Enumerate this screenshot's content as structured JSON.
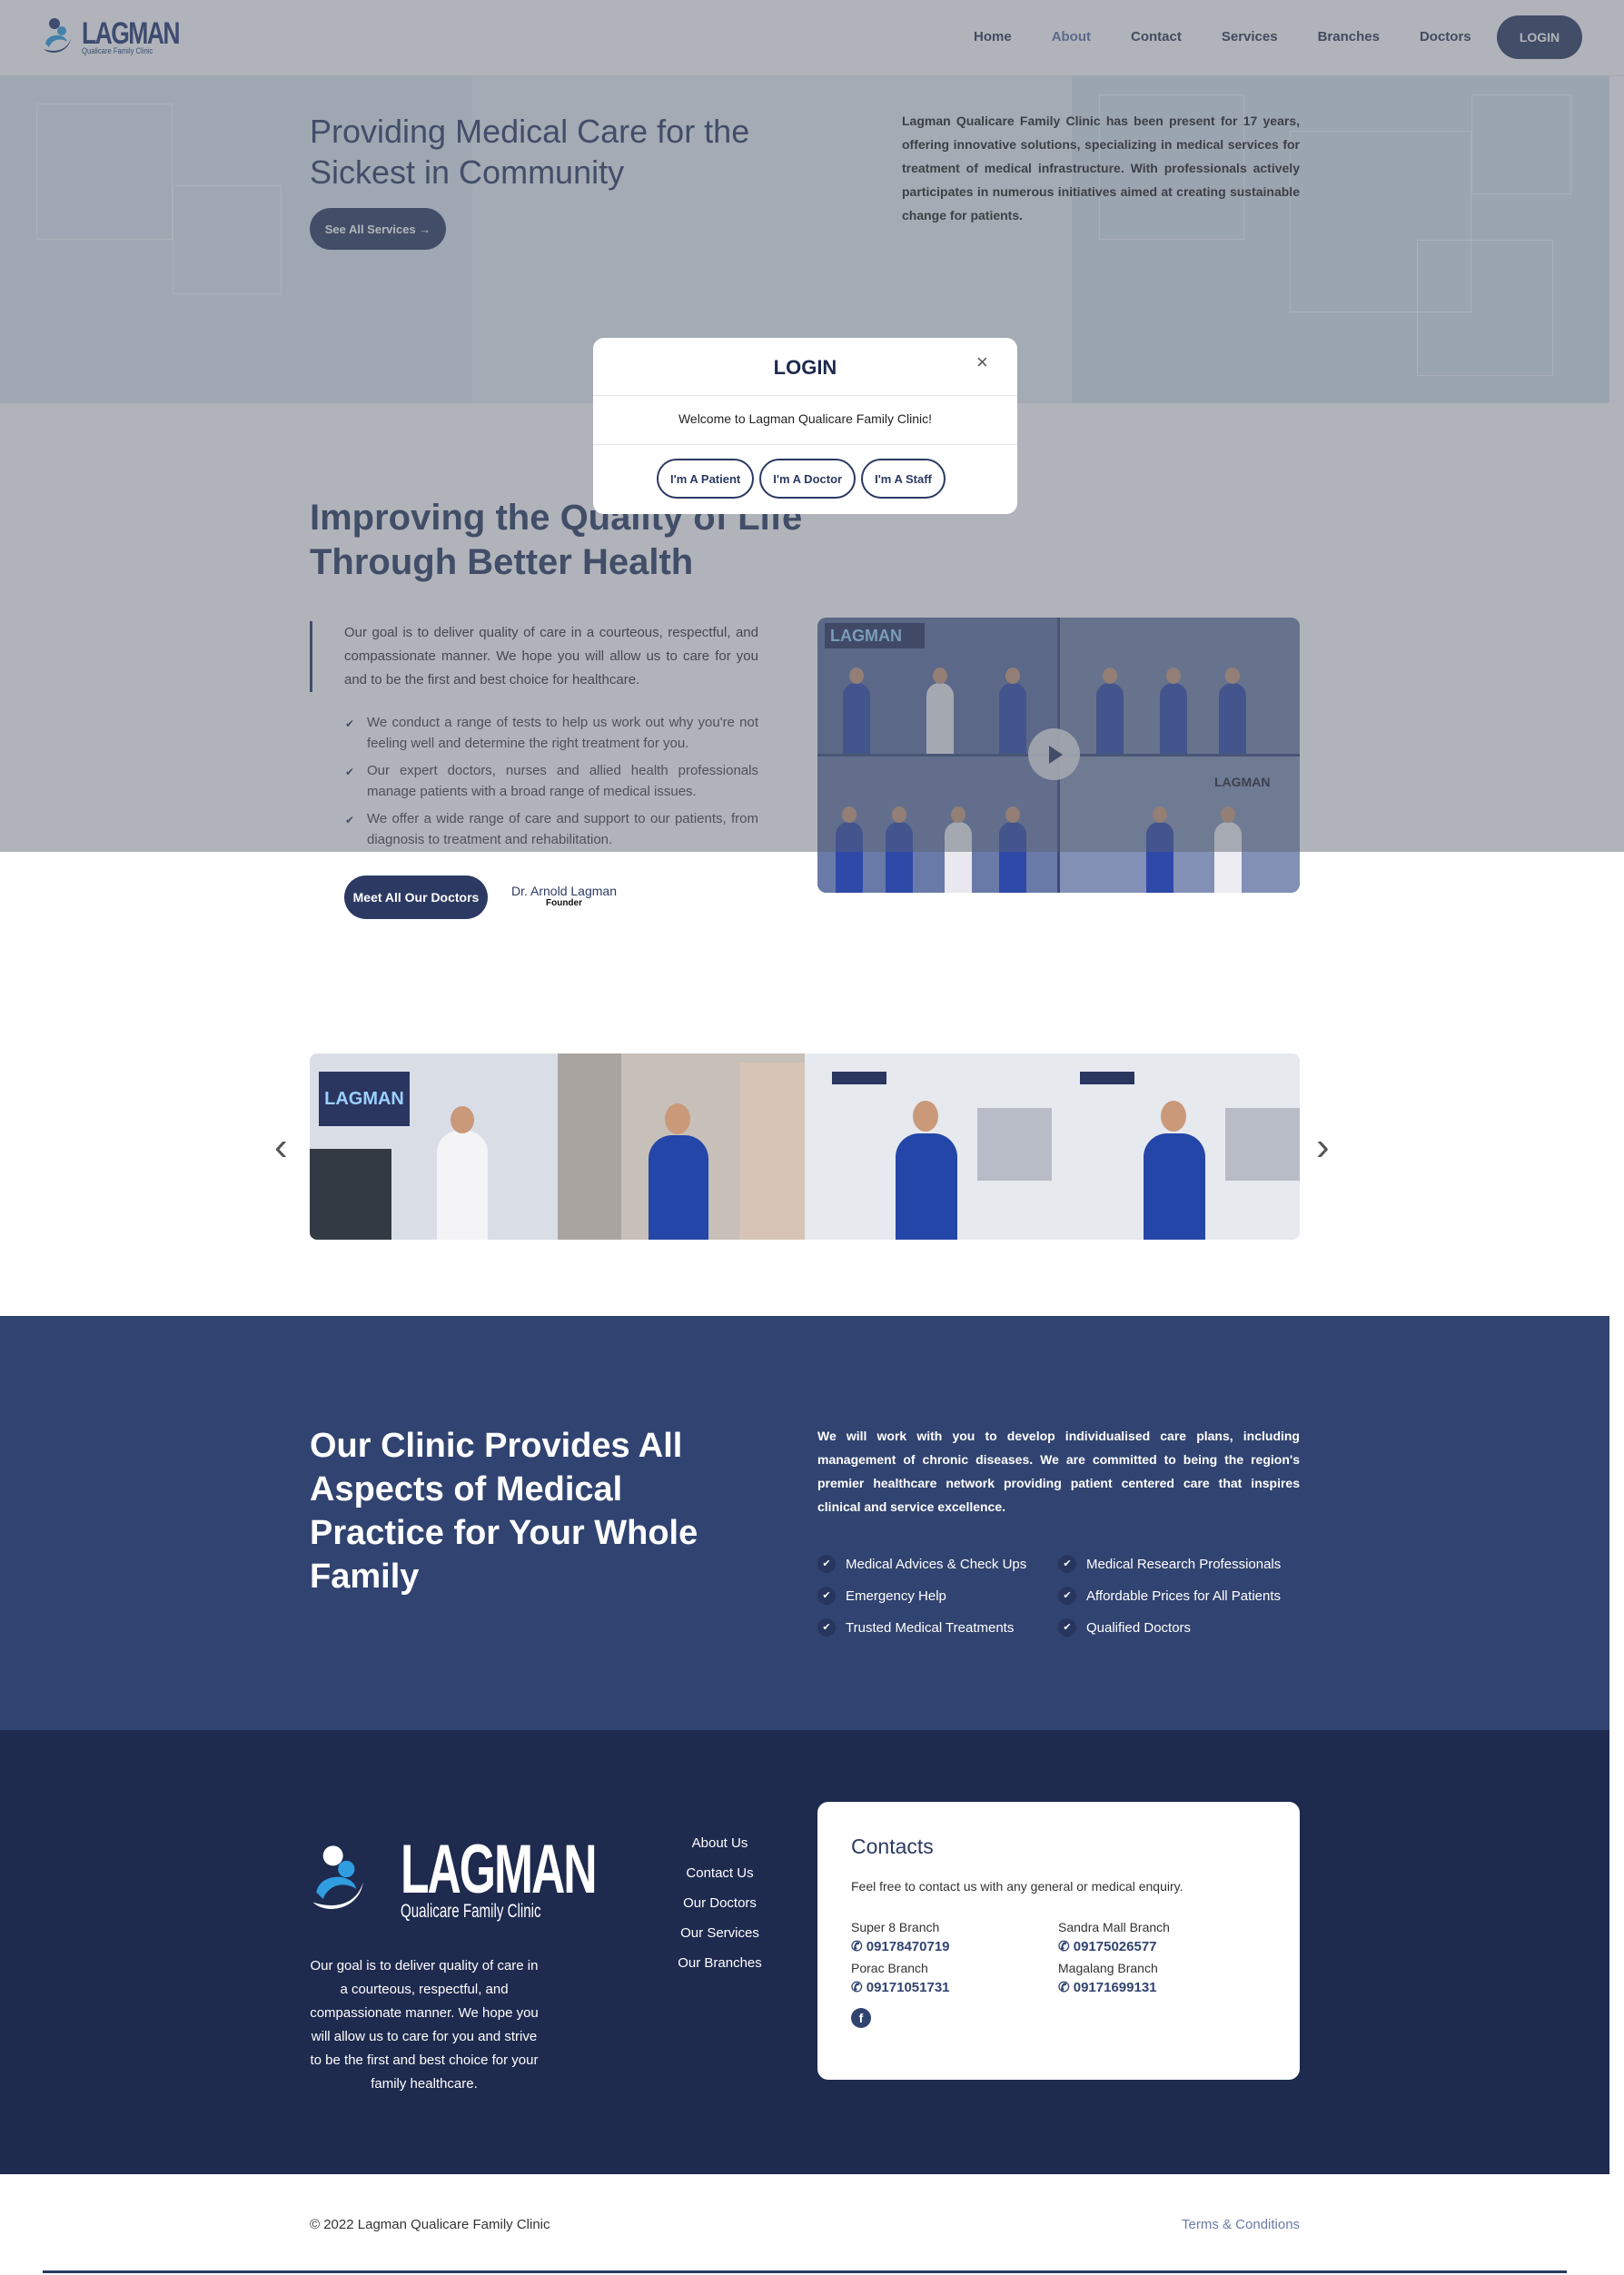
{
  "header": {
    "logo_title": "LAGMAN",
    "logo_subtitle": "Qualicare Family Clinic",
    "nav": [
      "Home",
      "About",
      "Contact",
      "Services",
      "Branches",
      "Doctors"
    ],
    "active_nav": "About",
    "login_label": "LOGIN"
  },
  "hero": {
    "title": "Providing Medical Care for the Sickest in Community",
    "button_label": "See All Services →",
    "text": "Lagman Qualicare Family Clinic has been present for 17 years, offering innovative solutions, specializing in medical services for treatment of medical infrastructure. With professionals actively participates in numerous initiatives aimed at creating sustainable change for patients."
  },
  "about": {
    "title": "Improving the Quality of Life Through Better Health",
    "quote": "Our goal is to deliver quality of care in a courteous, respectful, and compassionate manner. We hope you will allow us to care for you and to be the first and best choice for healthcare.",
    "points": [
      "We conduct a range of tests to help us work out why you're not feeling well and determine the right treatment for you.",
      "Our expert doctors, nurses and allied health professionals manage patients with a broad range of medical issues.",
      "We offer a wide range of care and support to our patients, from diagnosis to treatment and rehabilitation."
    ],
    "button_label": "Meet All Our Doctors",
    "signature_name": "Dr. Arnold Lagman",
    "signature_role": "Founder",
    "video_sign_text": "LAGMAN"
  },
  "carousel": {
    "prev_icon": "chevron-left-icon",
    "next_icon": "chevron-right-icon",
    "sign_text": "LAGMAN"
  },
  "practice": {
    "title": "Our Clinic Provides All Aspects of Medical Practice for Your Whole Family",
    "text": "We will work with you to develop individualised care plans, including management of chronic diseases. We are committed to being the region's premier healthcare network providing patient centered care that inspires clinical and service excellence.",
    "features": [
      "Medical Advices & Check Ups",
      "Medical Research Professionals",
      "Emergency Help",
      "Affordable Prices for All Patients",
      "Trusted Medical Treatments",
      "Qualified Doctors"
    ]
  },
  "footer": {
    "logo_title": "LAGMAN",
    "logo_subtitle": "Qualicare Family Clinic",
    "description": "Our goal is to deliver quality of care in a courteous, respectful, and compassionate manner. We hope you will allow us to care for you and strive to be the first and best choice for your family healthcare.",
    "links": [
      "About Us",
      "Contact Us",
      "Our Doctors",
      "Our Services",
      "Our Branches"
    ],
    "contacts_title": "Contacts",
    "contacts_text": "Feel free to contact us with any general or medical enquiry.",
    "branches": [
      {
        "name": "Super 8 Branch",
        "phone": "09178470719"
      },
      {
        "name": "Sandra Mall Branch",
        "phone": "09175026577"
      },
      {
        "name": "Porac Branch",
        "phone": "09171051731"
      },
      {
        "name": "Magalang Branch",
        "phone": "09171699131"
      }
    ],
    "facebook_icon": "f",
    "copyright": "© 2022 Lagman Qualicare Family Clinic",
    "terms": "Terms & Conditions"
  },
  "modal": {
    "title": "LOGIN",
    "close_icon": "×",
    "message": "Welcome to Lagman Qualicare Family Clinic!",
    "roles": [
      "I'm A Patient",
      "I'm A Doctor",
      "I'm A Staff"
    ]
  },
  "colors": {
    "primary": "#2c3a63",
    "practice_bg": "#314370",
    "footer_bg": "#1e2a4e",
    "overlay": "rgba(90,98,110,0.48)"
  }
}
